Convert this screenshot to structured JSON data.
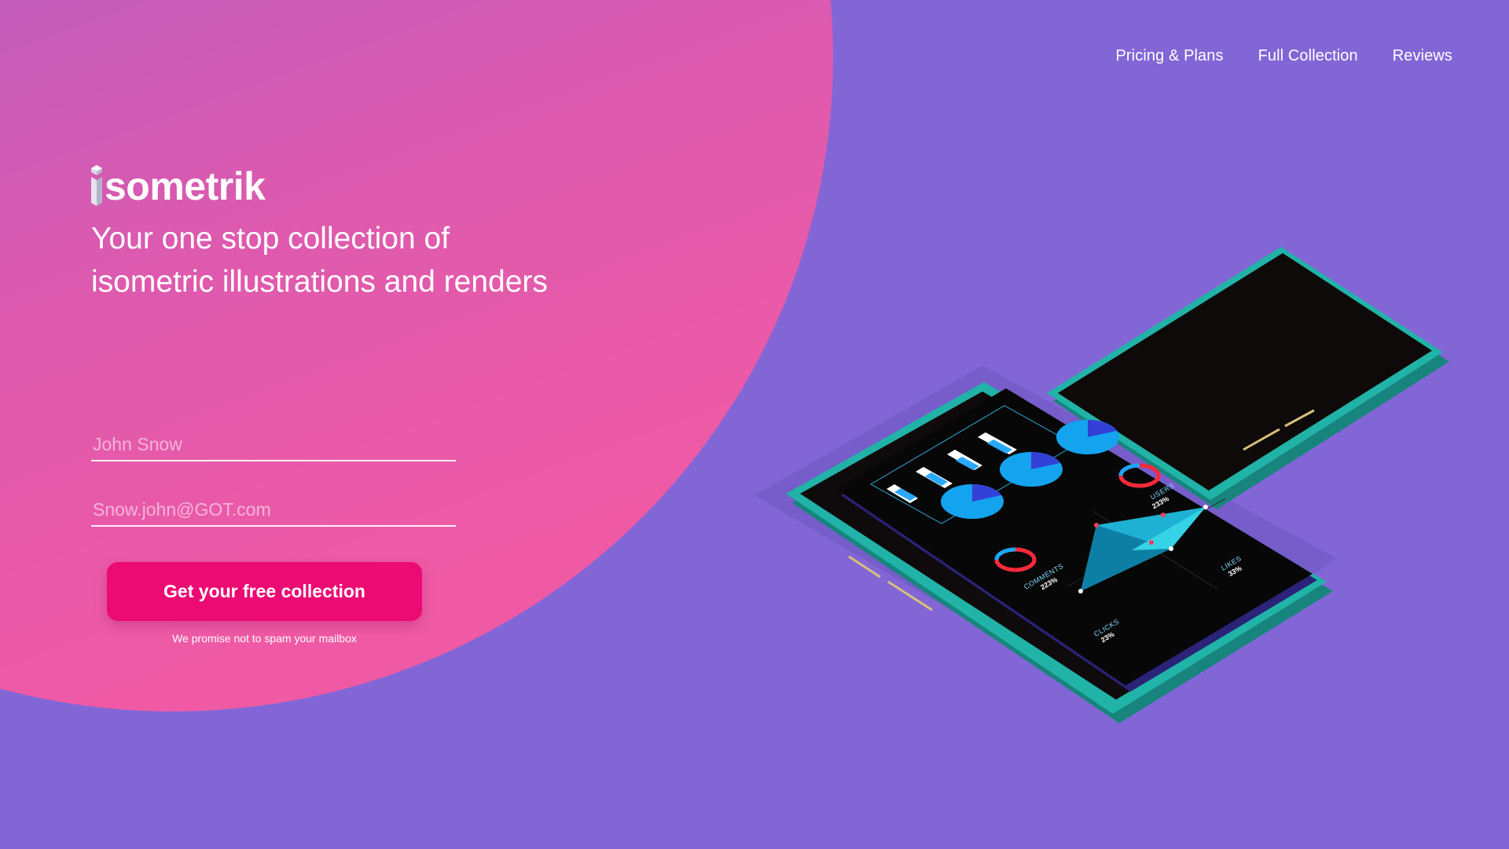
{
  "nav": {
    "items": [
      {
        "label": "Pricing & Plans"
      },
      {
        "label": "Full Collection"
      },
      {
        "label": "Reviews"
      }
    ]
  },
  "brand": {
    "name": "sometrik",
    "mark_letter": "i"
  },
  "hero": {
    "tagline_line1": "Your one stop collection of",
    "tagline_line2": "isometric illustrations and renders"
  },
  "form": {
    "name_placeholder": "John Snow",
    "email_placeholder": "Snow.john@GOT.com",
    "submit_label": "Get your free collection",
    "disclaimer": "We promise not to spam your mailbox"
  },
  "phone_screen": {
    "stats": [
      {
        "label": "USERS",
        "value": "233%"
      },
      {
        "label": "COMMENTS",
        "value": "223%"
      },
      {
        "label": "LIKES",
        "value": "33%"
      },
      {
        "label": "CLICKS",
        "value": "23%"
      }
    ]
  },
  "colors": {
    "background": "#8266d6",
    "blob_top": "#9a62c9",
    "blob_bottom": "#f05aa5",
    "cta": "#ec0a73",
    "phone_case": "#21b3a8"
  }
}
